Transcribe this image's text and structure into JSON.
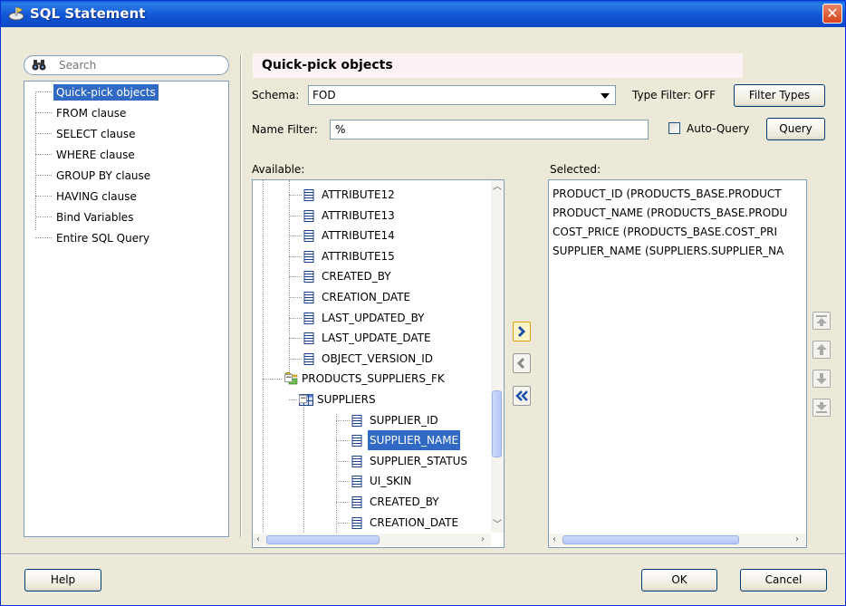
{
  "window": {
    "title": "SQL Statement"
  },
  "nav": {
    "search_placeholder": "Search",
    "items": [
      {
        "label": "Quick-pick objects",
        "selected": true
      },
      {
        "label": "FROM clause"
      },
      {
        "label": "SELECT clause"
      },
      {
        "label": "WHERE clause"
      },
      {
        "label": "GROUP BY clause"
      },
      {
        "label": "HAVING clause"
      },
      {
        "label": "Bind Variables"
      },
      {
        "label": "Entire SQL Query"
      }
    ]
  },
  "panel": {
    "heading": "Quick-pick objects",
    "schema_label": "Schema:",
    "schema_value": "FOD",
    "type_filter_label": "Type Filter: OFF",
    "filter_types_button": "Filter Types",
    "name_filter_label": "Name Filter:",
    "name_filter_value": "%",
    "auto_query_label": "Auto-Query",
    "query_button": "Query",
    "available_label": "Available:",
    "selected_label": "Selected:"
  },
  "available_tree": [
    {
      "label": "ATTRIBUTE12",
      "type": "column"
    },
    {
      "label": "ATTRIBUTE13",
      "type": "column"
    },
    {
      "label": "ATTRIBUTE14",
      "type": "column"
    },
    {
      "label": "ATTRIBUTE15",
      "type": "column"
    },
    {
      "label": "CREATED_BY",
      "type": "column"
    },
    {
      "label": "CREATION_DATE",
      "type": "column"
    },
    {
      "label": "LAST_UPDATED_BY",
      "type": "column"
    },
    {
      "label": "LAST_UPDATE_DATE",
      "type": "column"
    },
    {
      "label": "OBJECT_VERSION_ID",
      "type": "column"
    },
    {
      "label": "PRODUCTS_SUPPLIERS_FK",
      "type": "fk"
    },
    {
      "label": "SUPPLIERS",
      "type": "table"
    },
    {
      "label": "SUPPLIER_ID",
      "type": "column"
    },
    {
      "label": "SUPPLIER_NAME",
      "type": "column",
      "selected": true
    },
    {
      "label": "SUPPLIER_STATUS",
      "type": "column"
    },
    {
      "label": "UI_SKIN",
      "type": "column"
    },
    {
      "label": "CREATED_BY",
      "type": "column"
    },
    {
      "label": "CREATION_DATE",
      "type": "column"
    }
  ],
  "selected_list": [
    "PRODUCT_ID (PRODUCTS_BASE.PRODUCT",
    "PRODUCT_NAME (PRODUCTS_BASE.PRODU",
    "COST_PRICE (PRODUCTS_BASE.COST_PRI",
    "SUPPLIER_NAME (SUPPLIERS.SUPPLIER_NA"
  ],
  "footer": {
    "help": "Help",
    "ok": "OK",
    "cancel": "Cancel"
  },
  "colors": {
    "accent": "#316ac5",
    "titlebar": "#0b47c4",
    "dialog_bg": "#ece9d8"
  }
}
